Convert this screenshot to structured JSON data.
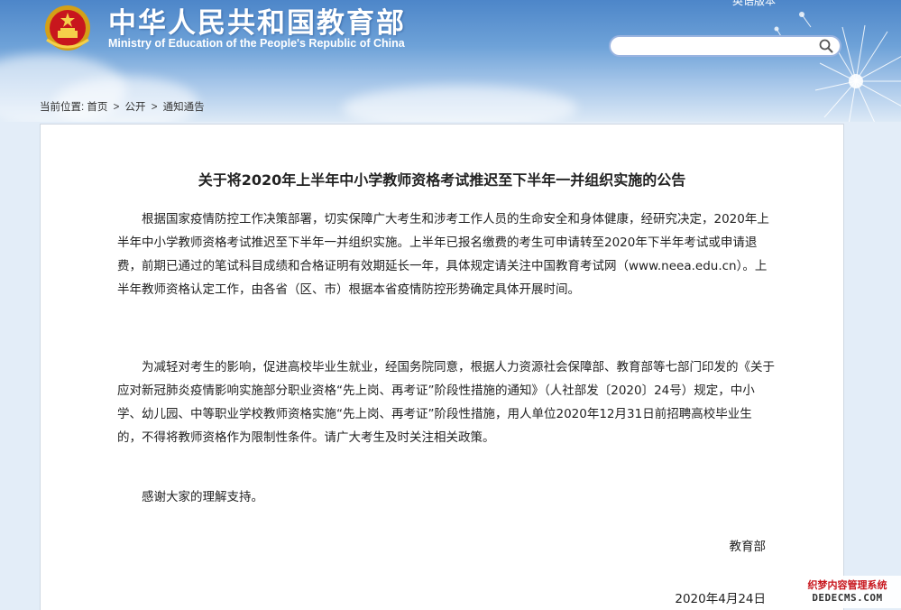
{
  "header": {
    "title_cn": "中华人民共和国教育部",
    "title_en": "Ministry of Education of the People's Republic of China",
    "top_link": "英语版本",
    "search": {
      "value": "",
      "placeholder": ""
    }
  },
  "breadcrumb": {
    "prefix": "当前位置:",
    "items": [
      "首页",
      "公开",
      "通知通告"
    ],
    "separator": ">"
  },
  "article": {
    "title": "关于将2020年上半年中小学教师资格考试推迟至下半年一并组织实施的公告",
    "paragraphs": [
      "根据国家疫情防控工作决策部署，切实保障广大考生和涉考工作人员的生命安全和身体健康，经研究决定，2020年上半年中小学教师资格考试推迟至下半年一并组织实施。上半年已报名缴费的考生可申请转至2020年下半年考试或申请退费，前期已通过的笔试科目成绩和合格证明有效期延长一年，具体规定请关注中国教育考试网（www.neea.edu.cn）。上半年教师资格认定工作，由各省（区、市）根据本省疫情防控形势确定具体开展时间。",
      "为减轻对考生的影响，促进高校毕业生就业，经国务院同意，根据人力资源社会保障部、教育部等七部门印发的《关于应对新冠肺炎疫情影响实施部分职业资格“先上岗、再考证”阶段性措施的通知》（人社部发〔2020〕24号）规定，中小学、幼儿园、中等职业学校教师资格实施“先上岗、再考证”阶段性措施，用人单位2020年12月31日前招聘高校毕业生的，不得将教师资格作为限制性条件。请广大考生及时关注相关政策。",
      "感谢大家的理解支持。"
    ],
    "signature": "教育部",
    "date": "2020年4月24日"
  },
  "watermark": {
    "line1": "织梦内容管理系统",
    "line2": "DEDECMS.COM"
  },
  "colors": {
    "header_top": "#4d86c9",
    "header_bottom": "#dce9f6",
    "page_bg": "#e3edf8",
    "search_border": "#9ab4e0",
    "watermark_red": "#c8161d"
  }
}
